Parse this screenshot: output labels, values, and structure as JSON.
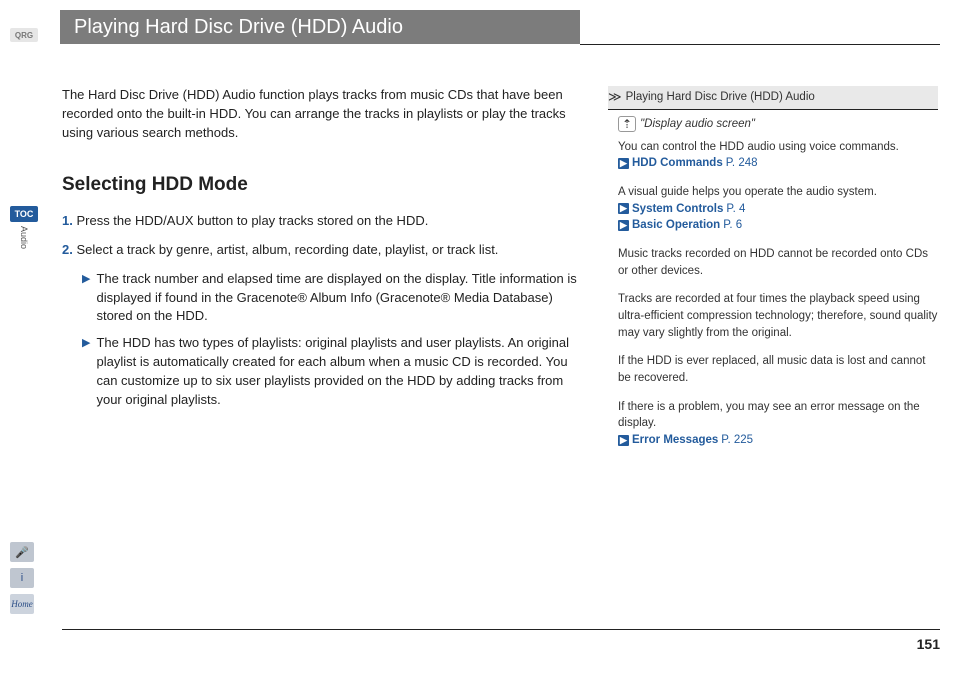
{
  "sidebar": {
    "qrg": "QRG",
    "toc": "TOC",
    "vertical_label": "Audio",
    "voice_icon": "🎤",
    "info_icon": "i",
    "home_icon": "Home"
  },
  "title": "Playing Hard Disc Drive (HDD) Audio",
  "intro": "The Hard Disc Drive (HDD) Audio function plays tracks from music CDs that have been recorded onto the built-in HDD. You can arrange the tracks in playlists or play the tracks using various search methods.",
  "section_heading": "Selecting HDD Mode",
  "steps": [
    {
      "num": "1.",
      "text": "Press the HDD/AUX button to play tracks stored on the HDD."
    },
    {
      "num": "2.",
      "text": "Select a track by genre, artist, album, recording date, playlist, or track list."
    }
  ],
  "bullets": [
    "The track number and elapsed time are displayed on the display. Title information is displayed if found in the Gracenote® Album Info (Gracenote® Media Database) stored on the HDD.",
    "The HDD has two types of playlists: original playlists and user playlists. An original playlist is automatically created for each album when a music CD is recorded. You can customize up to six user playlists provided on the HDD by adding tracks from your original playlists."
  ],
  "side": {
    "header": "Playing Hard Disc Drive (HDD) Audio",
    "voice_command": "\"Display audio screen\"",
    "blocks": [
      {
        "text": "You can control the HDD audio using voice commands.",
        "links": [
          {
            "label": "HDD Commands",
            "page": "P. 248"
          }
        ]
      },
      {
        "text": "A visual guide helps you operate the audio system.",
        "links": [
          {
            "label": "System Controls",
            "page": "P. 4"
          },
          {
            "label": "Basic Operation",
            "page": "P. 6"
          }
        ]
      },
      {
        "text": "Music tracks recorded on HDD cannot be recorded onto CDs or other devices.",
        "links": []
      },
      {
        "text": "Tracks are recorded at four times the playback speed using ultra-efficient compression technology; therefore, sound quality may vary slightly from the original.",
        "links": []
      },
      {
        "text": "If the HDD is ever replaced, all music data is lost and cannot be recovered.",
        "links": []
      },
      {
        "text": "If there is a problem, you may see an error message on the display.",
        "links": [
          {
            "label": "Error Messages",
            "page": "P. 225"
          }
        ]
      }
    ]
  },
  "page_number": "151"
}
